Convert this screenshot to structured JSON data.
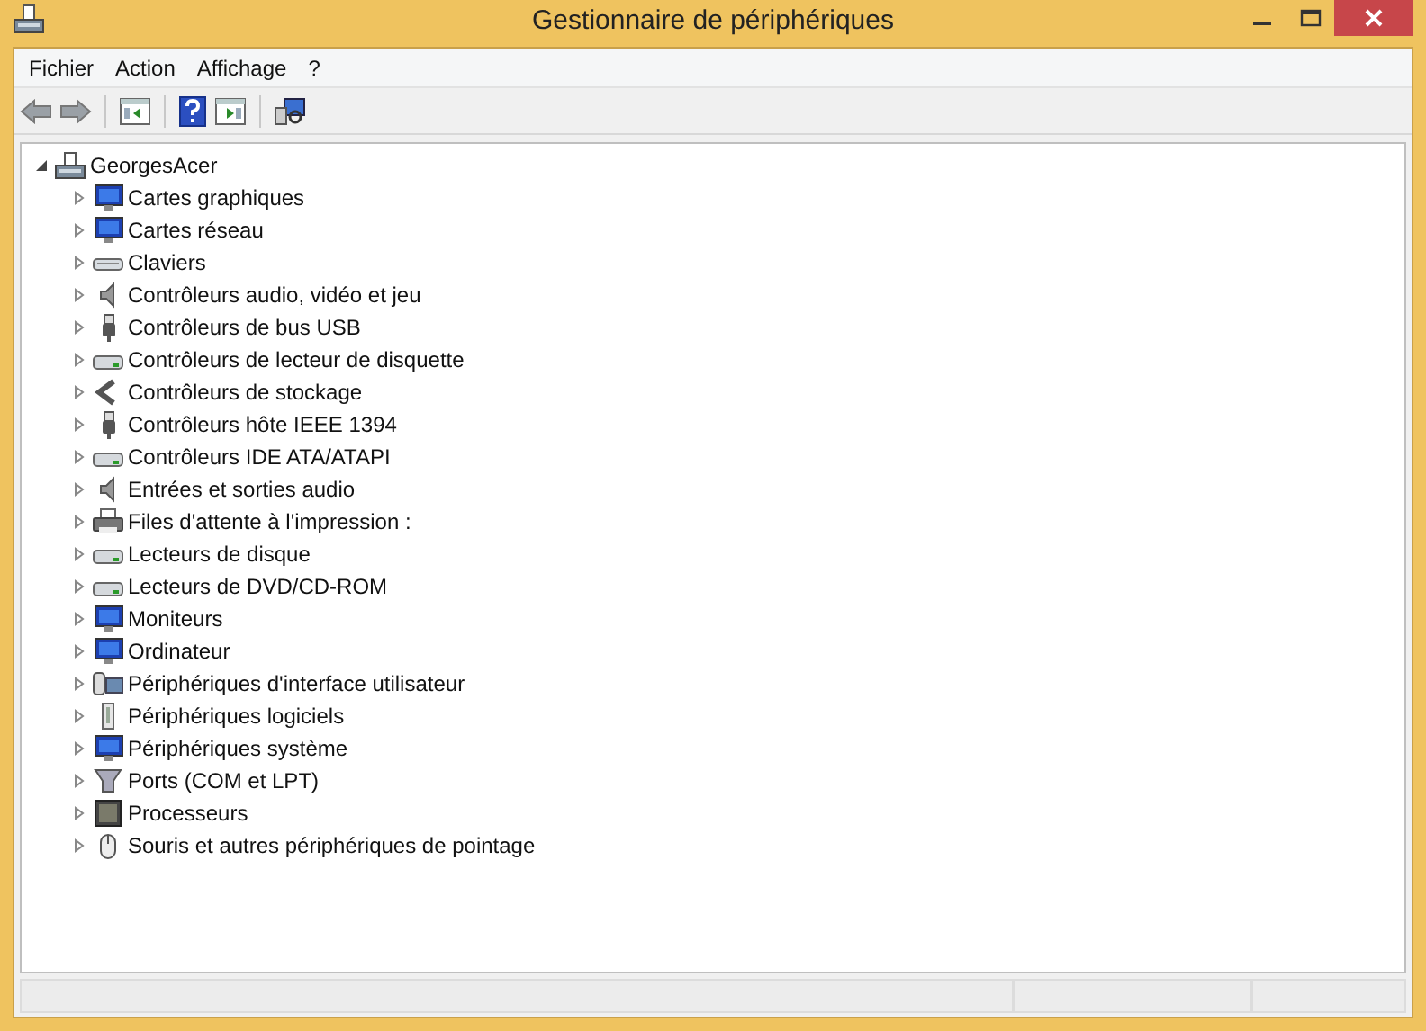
{
  "window": {
    "title": "Gestionnaire de périphériques"
  },
  "menu": [
    "Fichier",
    "Action",
    "Affichage",
    "?"
  ],
  "tree": {
    "label": "GeorgesAcer",
    "expanded": true,
    "children": [
      {
        "label": "Cartes graphiques",
        "expanded": false
      },
      {
        "label": "Cartes réseau",
        "expanded": false
      },
      {
        "label": "Claviers",
        "expanded": false
      },
      {
        "label": "Contrôleurs audio, vidéo et jeu",
        "expanded": false
      },
      {
        "label": "Contrôleurs de bus USB",
        "expanded": false
      },
      {
        "label": "Contrôleurs de lecteur de disquette",
        "expanded": false
      },
      {
        "label": "Contrôleurs de stockage",
        "expanded": false
      },
      {
        "label": "Contrôleurs hôte IEEE 1394",
        "expanded": false
      },
      {
        "label": "Contrôleurs IDE ATA/ATAPI",
        "expanded": false
      },
      {
        "label": "Entrées et sorties audio",
        "expanded": false
      },
      {
        "label": "Files d'attente à l'impression :",
        "expanded": false
      },
      {
        "label": "Lecteurs de disque",
        "expanded": false
      },
      {
        "label": "Lecteurs de DVD/CD-ROM",
        "expanded": false
      },
      {
        "label": "Moniteurs",
        "expanded": false
      },
      {
        "label": "Ordinateur",
        "expanded": false
      },
      {
        "label": "Périphériques d'interface utilisateur",
        "expanded": false
      },
      {
        "label": "Périphériques logiciels",
        "expanded": false
      },
      {
        "label": "Périphériques système",
        "expanded": false
      },
      {
        "label": "Ports (COM et LPT)",
        "expanded": false
      },
      {
        "label": "Processeurs",
        "expanded": false
      },
      {
        "label": "Souris et autres périphériques de pointage",
        "expanded": false
      }
    ]
  }
}
